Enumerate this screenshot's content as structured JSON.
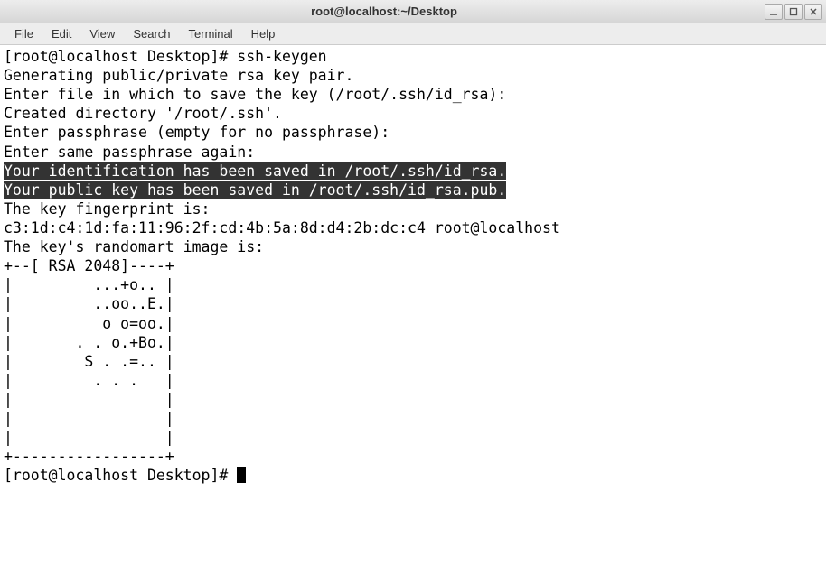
{
  "window": {
    "title": "root@localhost:~/Desktop"
  },
  "menu": {
    "file": "File",
    "edit": "Edit",
    "view": "View",
    "search": "Search",
    "terminal": "Terminal",
    "help": "Help"
  },
  "lines": {
    "l0": "[root@localhost Desktop]# ssh-keygen",
    "l1": "Generating public/private rsa key pair.",
    "l2": "Enter file in which to save the key (/root/.ssh/id_rsa):",
    "l3": "Created directory '/root/.ssh'.",
    "l4": "Enter passphrase (empty for no passphrase):",
    "l5": "Enter same passphrase again:",
    "l6": "Your identification has been saved in /root/.ssh/id_rsa.",
    "l7": "Your public key has been saved in /root/.ssh/id_rsa.pub.",
    "l8": "The key fingerprint is:",
    "l9": "c3:1d:c4:1d:fa:11:96:2f:cd:4b:5a:8d:d4:2b:dc:c4 root@localhost",
    "l10": "The key's randomart image is:",
    "l11": "+--[ RSA 2048]----+",
    "l12": "|         ...+o.. |",
    "l13": "|         ..oo..E.|",
    "l14": "|          o o=oo.|",
    "l15": "|       . . o.+Bo.|",
    "l16": "|        S . .=.. |",
    "l17": "|         . . .   |",
    "l18": "|                 |",
    "l19": "|                 |",
    "l20": "|                 |",
    "l21": "+-----------------+",
    "l22": "[root@localhost Desktop]# "
  }
}
